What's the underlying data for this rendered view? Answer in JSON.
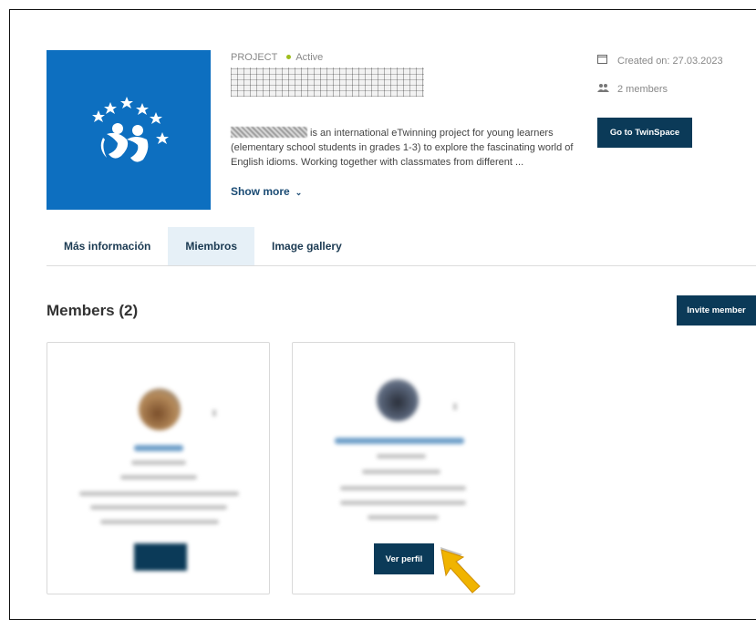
{
  "project": {
    "label": "PROJECT",
    "status": "Active",
    "description": "is an international eTwinning project for young learners (elementary school students in grades 1-3) to explore the fascinating world of English idioms. Working together with classmates from different ...",
    "show_more": "Show more",
    "show_more_icon": "chevron-down-icon",
    "created": "Created on: 27.03.2023",
    "members_count": "2 members",
    "twinspace_button": "Go to TwinSpace"
  },
  "tabs": [
    {
      "label": "Más información"
    },
    {
      "label": "Miembros",
      "active": true
    },
    {
      "label": "Image gallery"
    }
  ],
  "members": {
    "heading": "Members (2)",
    "invite_button": "Invite member",
    "cards": [
      {
        "button_label": ""
      },
      {
        "button_label": "Ver perfil"
      }
    ]
  },
  "colors": {
    "brand_blue": "#0d6fc0",
    "dark_button": "#0b3a58",
    "active_dot": "#9ebd1c",
    "cursor": "#f0b400"
  },
  "icons": [
    "project-logo-icon",
    "calendar-icon",
    "members-icon",
    "chevron-down-icon",
    "pointer-cursor-icon"
  ]
}
